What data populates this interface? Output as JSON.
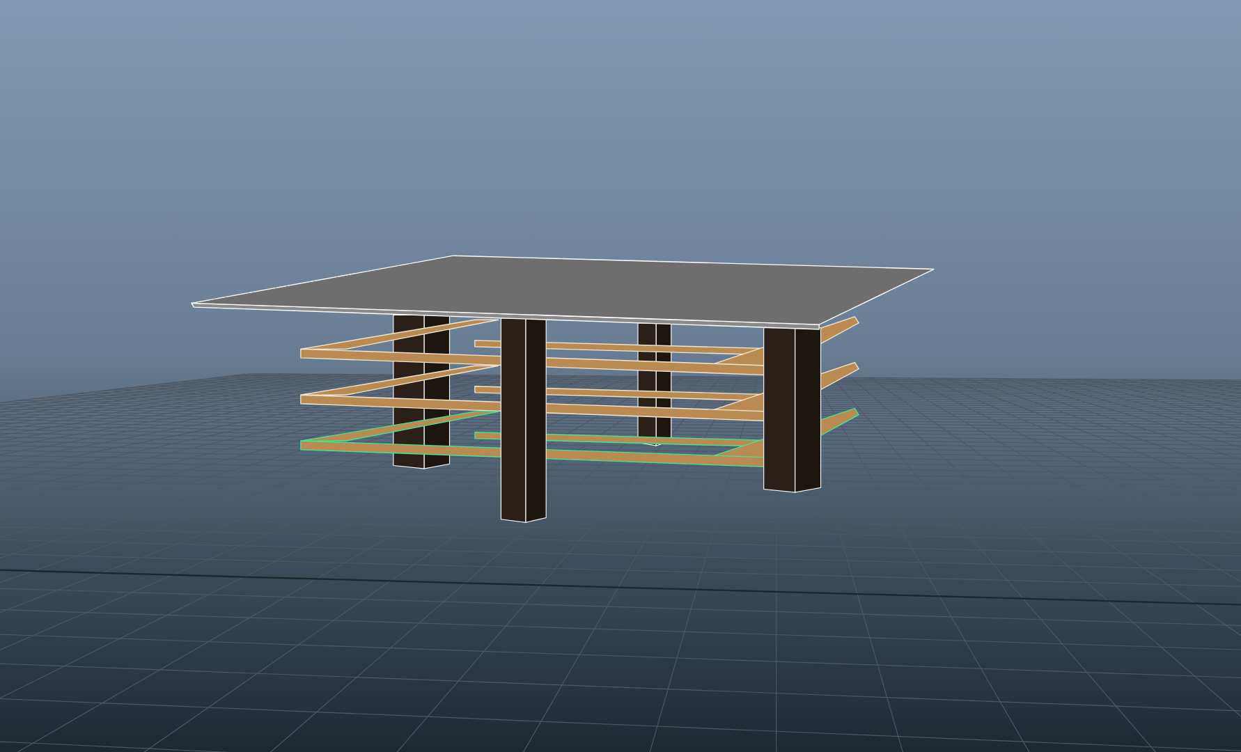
{
  "viewport": {
    "grid": true
  },
  "shelves": [
    {
      "selected": false
    },
    {
      "selected": false
    },
    {
      "selected": true
    }
  ]
}
